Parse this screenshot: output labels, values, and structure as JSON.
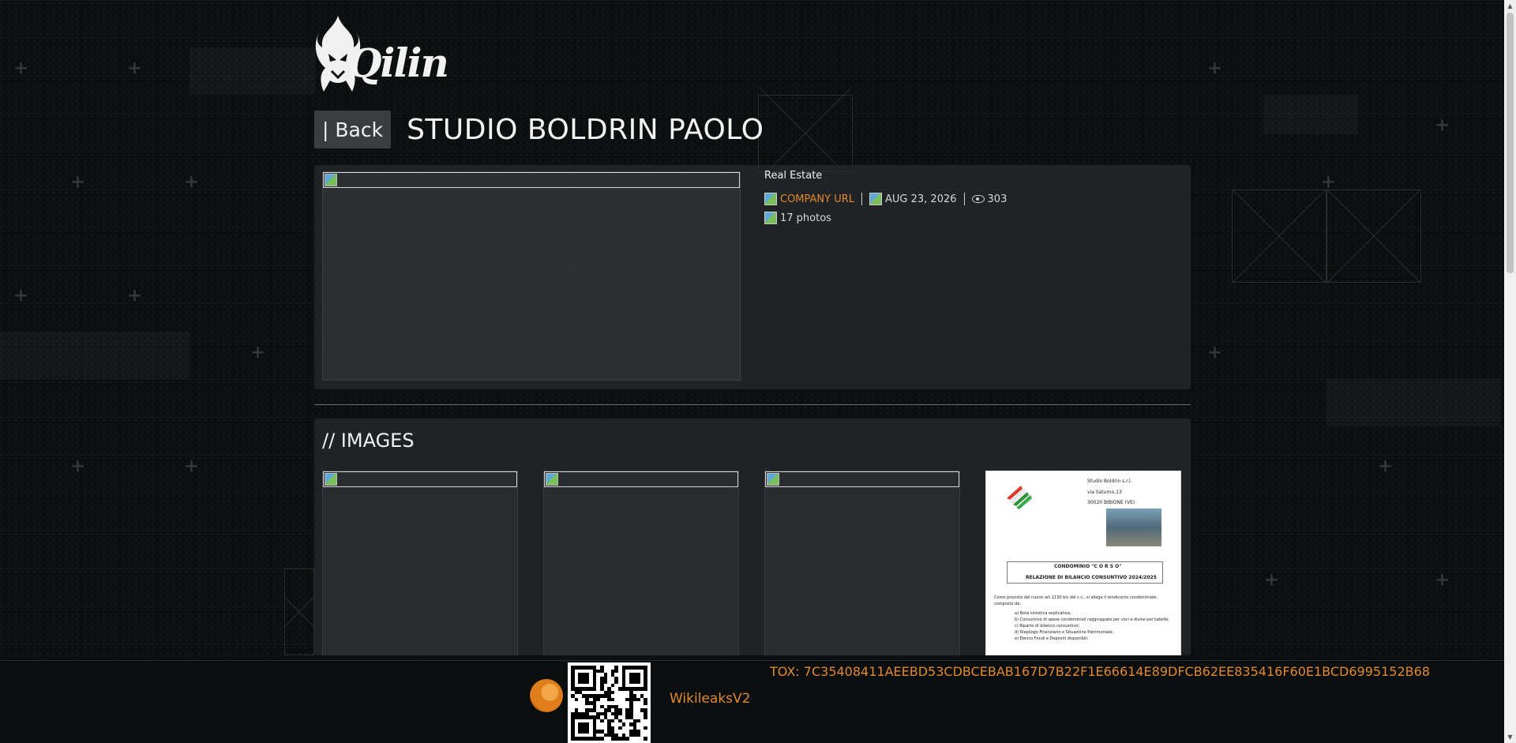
{
  "brand": {
    "logo_text": "Qilin"
  },
  "header": {
    "back_label": "| Back",
    "title": "STUDIO BOLDRIN PAOLO"
  },
  "company": {
    "category": "Real Estate",
    "company_url_label": "COMPANY URL",
    "date": "AUG 23, 2026",
    "views": "303",
    "photos": "17 photos"
  },
  "images_section": {
    "heading": "// IMAGES",
    "document_preview": {
      "lines": [
        "Studio Boldrin s.r.l.",
        "via Saturno,13",
        "30020 BIBIONE   (VE)",
        "CONDOMINIO \"C O R S O\"",
        "RELAZIONE DI BILANCIO CONSUNTIVO 2024/2025",
        "Come previsto dal nuovo art.1130 bis del c.c., si allega il rendiconto condominiale,",
        "composto da:",
        "a)   Nota sintetica esplicativa;",
        "b)   Consuntivo di spese condominiali raggruppate per voci e divise per tabelle;",
        "c)   Riparto di bilancio consuntivo;",
        "d)   Riepilogo Finanziario e Situazione Patrimoniale;",
        "e)   Elenco Fondi e Depositi disponibili."
      ]
    }
  },
  "footer": {
    "link_label": "WikileaksV2",
    "tox": "TOX: 7C35408411AEEBD53CDBCEBAB167D7B22F1E66614E89DFCB62EE835416F60E1BCD6995152B68"
  },
  "colors": {
    "accent": "#e0892d",
    "background": "#0c0f10",
    "panel": "#2a2d30"
  }
}
